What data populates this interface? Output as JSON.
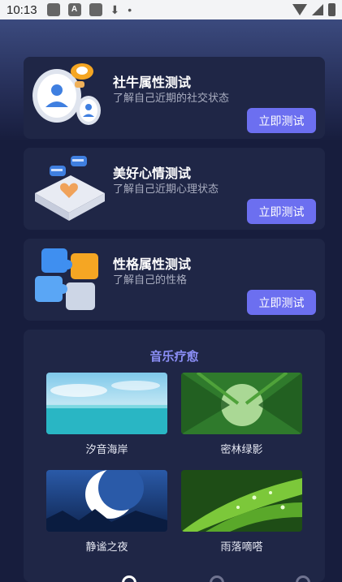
{
  "status_bar": {
    "time": "10:13",
    "icon_a": "A",
    "dot": "•"
  },
  "cards": [
    {
      "title": "社牛属性测试",
      "subtitle": "了解自己近期的社交状态",
      "button": "立即测试",
      "icon": "person-coin-icon"
    },
    {
      "title": "美好心情测试",
      "subtitle": "了解自己近期心理状态",
      "button": "立即测试",
      "icon": "heart-chat-icon"
    },
    {
      "title": "性格属性测试",
      "subtitle": "了解自己的性格",
      "button": "立即测试",
      "icon": "puzzle-cubes-icon"
    }
  ],
  "music": {
    "title": "音乐疗愈",
    "tiles": [
      {
        "label": "汐音海岸",
        "image": "ocean-image"
      },
      {
        "label": "密林绿影",
        "image": "bamboo-forest-image"
      },
      {
        "label": "静谧之夜",
        "image": "moon-night-image"
      },
      {
        "label": "雨落嘀嗒",
        "image": "leaf-raindrops-image"
      }
    ]
  },
  "colors": {
    "background": "#171d3d",
    "card": "#1f2646",
    "accent": "#6c6ff0",
    "music_title": "#8b8ef5"
  }
}
